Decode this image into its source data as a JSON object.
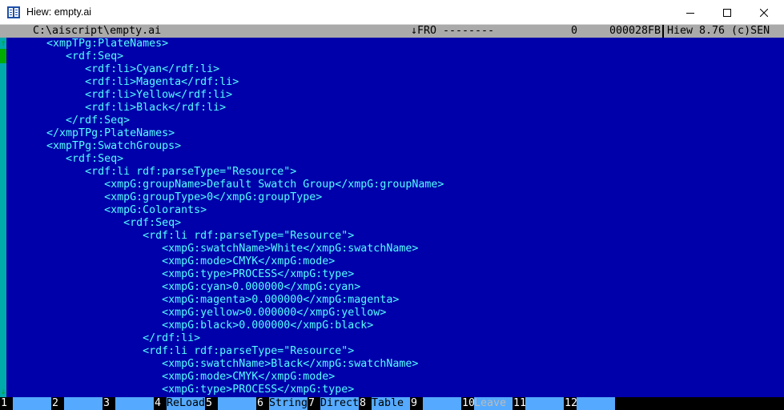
{
  "window": {
    "title": "Hiew: empty.ai"
  },
  "status": {
    "path": "C:\\aiscript\\empty.ai",
    "mode": "↓FRO --------",
    "offset": "0",
    "size": "000028FB",
    "version": "Hiew 8.76 (c)SEN"
  },
  "lines": [
    "      <xmpTPg:PlateNames>",
    "         <rdf:Seq>",
    "            <rdf:li>Cyan</rdf:li>",
    "            <rdf:li>Magenta</rdf:li>",
    "            <rdf:li>Yellow</rdf:li>",
    "            <rdf:li>Black</rdf:li>",
    "         </rdf:Seq>",
    "      </xmpTPg:PlateNames>",
    "      <xmpTPg:SwatchGroups>",
    "         <rdf:Seq>",
    "            <rdf:li rdf:parseType=\"Resource\">",
    "               <xmpG:groupName>Default Swatch Group</xmpG:groupName>",
    "               <xmpG:groupType>0</xmpG:groupType>",
    "               <xmpG:Colorants>",
    "                  <rdf:Seq>",
    "                     <rdf:li rdf:parseType=\"Resource\">",
    "                        <xmpG:swatchName>White</xmpG:swatchName>",
    "                        <xmpG:mode>CMYK</xmpG:mode>",
    "                        <xmpG:type>PROCESS</xmpG:type>",
    "                        <xmpG:cyan>0.000000</xmpG:cyan>",
    "                        <xmpG:magenta>0.000000</xmpG:magenta>",
    "                        <xmpG:yellow>0.000000</xmpG:yellow>",
    "                        <xmpG:black>0.000000</xmpG:black>",
    "                     </rdf:li>",
    "                     <rdf:li rdf:parseType=\"Resource\">",
    "                        <xmpG:swatchName>Black</xmpG:swatchName>",
    "                        <xmpG:mode>CMYK</xmpG:mode>",
    "                        <xmpG:type>PROCESS</xmpG:type>"
  ],
  "fkeys": [
    {
      "num": "1",
      "label": ""
    },
    {
      "num": "2",
      "label": ""
    },
    {
      "num": "3",
      "label": ""
    },
    {
      "num": "4",
      "label": "ReLoad"
    },
    {
      "num": "5",
      "label": ""
    },
    {
      "num": "6",
      "label": "String"
    },
    {
      "num": "7",
      "label": "Direct"
    },
    {
      "num": "8",
      "label": "Table"
    },
    {
      "num": "9",
      "label": ""
    },
    {
      "num": "10",
      "label": "Leave",
      "dim": true
    },
    {
      "num": "11",
      "label": ""
    },
    {
      "num": "12",
      "label": ""
    }
  ],
  "icons": {
    "app": "hiew-app-icon",
    "minimize": "minimize-icon",
    "maximize": "maximize-icon",
    "close": "close-icon",
    "scroll_up": "arrow-up-icon",
    "scroll_down": "arrow-down-icon"
  },
  "colors": {
    "background": "#0000AA",
    "text": "#55FFFF",
    "status_bar": "#AAAAAA",
    "fkey_label": "#55AAFF",
    "scrollbar": "#00AAAA",
    "scroll_arrow": "#00AA00"
  }
}
